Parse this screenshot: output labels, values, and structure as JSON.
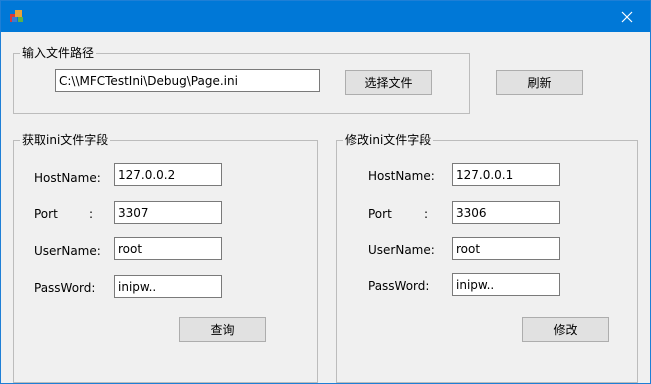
{
  "window": {
    "app_icon": "mfc-app-icon",
    "close_icon": "close-icon"
  },
  "file_group": {
    "title": "输入文件路径",
    "path_value": "C:\\\\MFCTestIni\\Debug\\Page.ini",
    "choose_file_label": "选择文件",
    "refresh_label": "刷新"
  },
  "get_group": {
    "title": "获取ini文件字段",
    "hostname_label": "HostName:",
    "hostname_value": "127.0.0.2",
    "port_label": "Port",
    "port_colon": ":",
    "port_value": "3307",
    "username_label": "UserName:",
    "username_value": "root",
    "password_label": "PassWord:",
    "password_value": "inipw..",
    "query_label": "查询"
  },
  "set_group": {
    "title": "修改ini文件字段",
    "hostname_label": "HostName:",
    "hostname_value": "127.0.0.1",
    "port_label": "Port",
    "port_colon": ":",
    "port_value": "3306",
    "username_label": "UserName:",
    "username_value": "root",
    "password_label": "PassWord:",
    "password_value": "inipw..",
    "modify_label": "修改"
  }
}
